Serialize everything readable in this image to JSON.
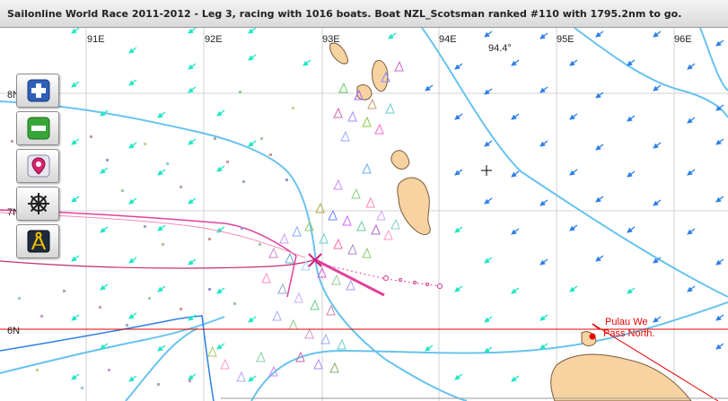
{
  "window": {
    "title": "Sailonline World Race 2011-2012 - Leg 3, racing with 1016 boats. Boat NZL_Scotsman ranked #110 with 1795.2nm to go."
  },
  "map": {
    "longitude_labels": [
      "91E",
      "92E",
      "93E",
      "94E",
      "95E",
      "96E"
    ],
    "cursor_longitude": "94.4°",
    "latitude_labels": [
      "8N",
      "7N",
      "6N"
    ],
    "waypoint": {
      "name": "Pulau We",
      "instruction": "Pass North."
    },
    "colors": {
      "land": "#f7d3a2",
      "wind_arrow_fast": "#21e6c6",
      "wind_arrow_slow": "#2e7fe6",
      "isobar": "#68c3ee",
      "own_track": "#e0429a",
      "waypoint": "#e60000"
    }
  },
  "tools": [
    {
      "id": "zoom-in",
      "icon": "plus-icon"
    },
    {
      "id": "zoom-out",
      "icon": "minus-icon"
    },
    {
      "id": "center-boat",
      "icon": "locate-boat-icon"
    },
    {
      "id": "helm",
      "icon": "ship-wheel-icon"
    },
    {
      "id": "measure",
      "icon": "compass-dividers-icon"
    }
  ]
}
